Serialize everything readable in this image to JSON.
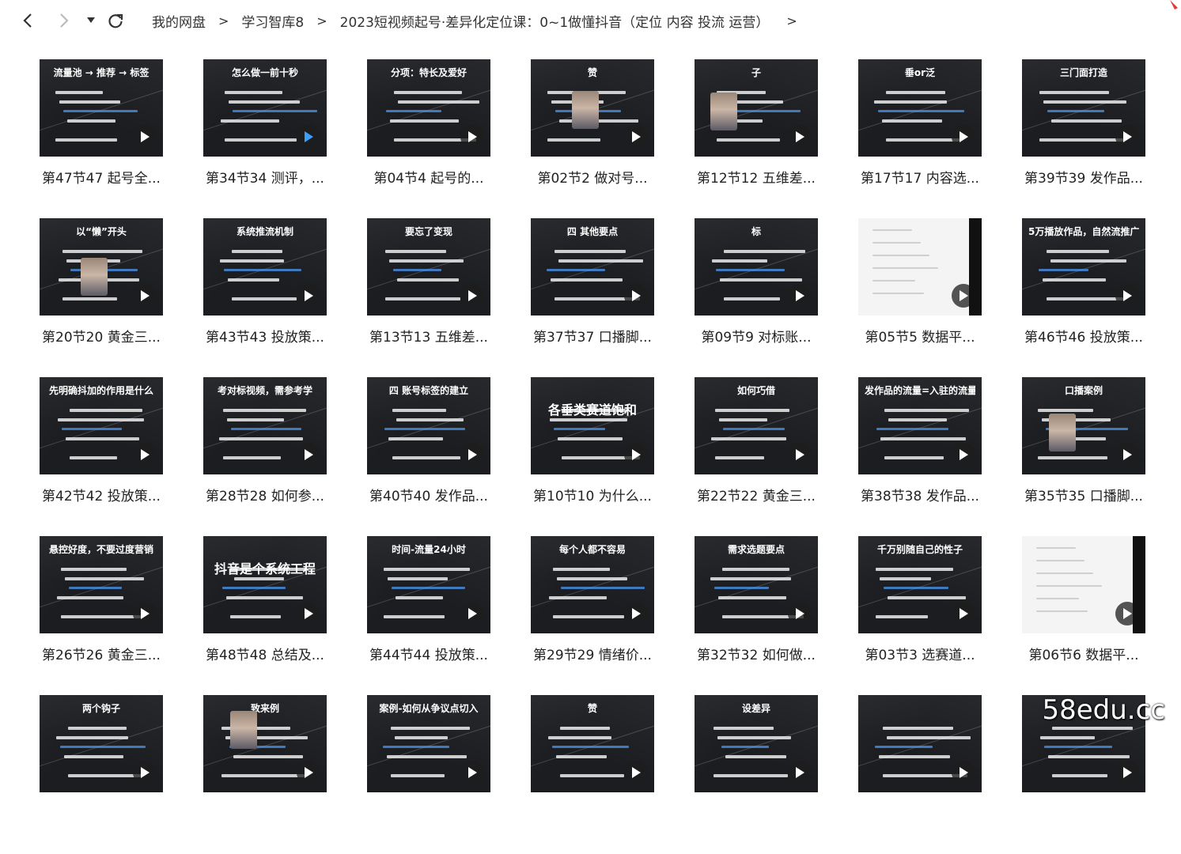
{
  "breadcrumb": {
    "items": [
      "我的网盘",
      "学习智库8",
      "2023短视频起号·差异化定位课：0~1做懂抖音（定位 内容 投流 运营）"
    ],
    "separator": ">"
  },
  "nav": {
    "back_icon": "chevron-left-icon",
    "forward_icon": "chevron-right-icon",
    "history_icon": "caret-down-icon",
    "refresh_icon": "refresh-icon"
  },
  "videos": [
    {
      "label": "第47节47 起号全...",
      "thumb": "流量池 → 推荐 → 标签"
    },
    {
      "label": "第34节34 测评，...",
      "thumb": "怎么做一前十秒"
    },
    {
      "label": "第04节4 起号的...",
      "thumb": "分项：特长及爱好"
    },
    {
      "label": "第02节2 做对号...",
      "thumb": "赞"
    },
    {
      "label": "第12节12 五维差...",
      "thumb": "子"
    },
    {
      "label": "第17节17 内容选...",
      "thumb": "垂or泛"
    },
    {
      "label": "第39节39 发作品...",
      "thumb": "三门面打造"
    },
    {
      "label": "第20节20 黄金三...",
      "thumb": "以“懒”开头"
    },
    {
      "label": "第43节43 投放策...",
      "thumb": "系统推流机制"
    },
    {
      "label": "第13节13 五维差...",
      "thumb": "要忘了变现"
    },
    {
      "label": "第37节37 口播脚...",
      "thumb": "四 其他要点"
    },
    {
      "label": "第09节9 对标账...",
      "thumb": "标"
    },
    {
      "label": "第05节5 数据平...",
      "thumb": ""
    },
    {
      "label": "第46节46 投放策...",
      "thumb": "5万播放作品，自然流推广"
    },
    {
      "label": "第42节42 投放策...",
      "thumb": "先明确抖加的作用是什么"
    },
    {
      "label": "第28节28 如何参...",
      "thumb": "考对标视频，需参考学"
    },
    {
      "label": "第40节40 发作品...",
      "thumb": "四 账号标签的建立"
    },
    {
      "label": "第10节10 为什么...",
      "thumb": "各垂类赛道饱和"
    },
    {
      "label": "第22节22 黄金三...",
      "thumb": "如何巧借"
    },
    {
      "label": "第38节38 发作品...",
      "thumb": "发作品的流量=入驻的流量"
    },
    {
      "label": "第35节35 口播脚...",
      "thumb": "口播案例"
    },
    {
      "label": "第26节26 黄金三...",
      "thumb": "悬控好度，不要过度营销"
    },
    {
      "label": "第48节48 总结及...",
      "thumb": "抖音是个系统工程"
    },
    {
      "label": "第44节44 投放策...",
      "thumb": "时间-流量24小时"
    },
    {
      "label": "第29节29 情绪价...",
      "thumb": "每个人都不容易"
    },
    {
      "label": "第32节32 如何做...",
      "thumb": "需求选题要点"
    },
    {
      "label": "第03节3 选赛道...",
      "thumb": "千万别随自己的性子"
    },
    {
      "label": "第06节6 数据平...",
      "thumb": ""
    },
    {
      "label": "",
      "thumb": "两个钩子"
    },
    {
      "label": "",
      "thumb": "致来例"
    },
    {
      "label": "",
      "thumb": "案例-如何从争议点切入"
    },
    {
      "label": "",
      "thumb": "赞"
    },
    {
      "label": "",
      "thumb": "设差异"
    },
    {
      "label": "",
      "thumb": ""
    },
    {
      "label": "",
      "thumb": ""
    }
  ],
  "watermark": "58edu.cc",
  "colors": {
    "accent": "#e53935",
    "thumb_bg": "#1b1d21",
    "text": "#222222"
  }
}
